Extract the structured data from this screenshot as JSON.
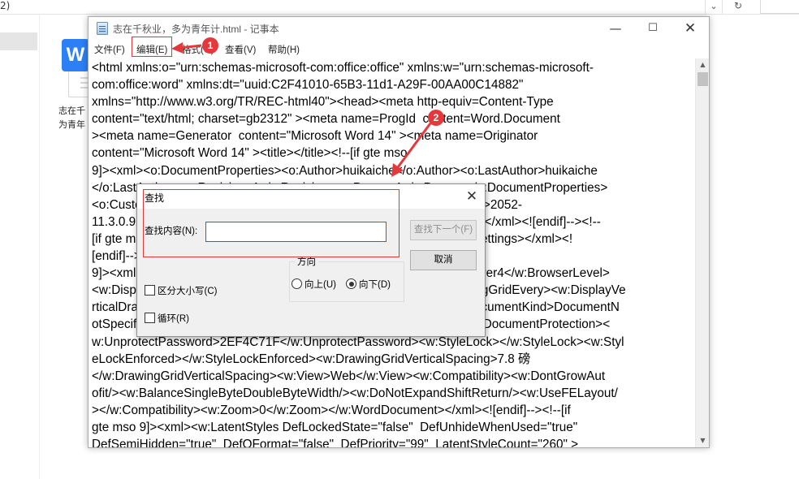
{
  "explorer": {
    "top_text": "2)",
    "refresh_icon": "refresh-icon",
    "file_name": "志在千秋业，多为青年计.docx",
    "file_name_line1": "志在千",
    "file_name_line2": "为青年",
    "file_badge": "W"
  },
  "notepad": {
    "title": "志在千秋业，多为青年计.html - 记事本",
    "menu": {
      "file": "文件(F)",
      "edit": "编辑(E)",
      "format": "格式(O)",
      "view": "查看(V)",
      "help": "帮助(H)"
    },
    "content": "<html xmlns:o=\"urn:schemas-microsoft-com:office:office\" xmlns:w=\"urn:schemas-microsoft-\ncom:office:word\" xmlns:dt=\"uuid:C2F41010-65B3-11d1-A29F-00AA00C14882\"\nxmlns=\"http://www.w3.org/TR/REC-html40\"><head><meta http-equiv=Content-Type\ncontent=\"text/html; charset=gb2312\" ><meta name=ProgId  content=Word.Document\n><meta name=Generator  content=\"Microsoft Word 14\" ><meta name=Originator\ncontent=\"Microsoft Word 14\" ><title></title><!--[if gte mso\n9]><xml><o:DocumentProperties><o:Author>huikaiche</o:Author><o:LastAuthor>huikaiche\n</o:LastAuthor><o:Revision>1</o:Revision><o:Pages>1</o:Pages></o:DocumentProperties>\n<o:CustomDocumentProperties><o:KSOProductBuildVer dt:dt=\"string\" >2052-\n11.3.0.9228</o:KSOProductBuildVer></o:CustomDocumentProperties></xml><![endif]--><!--\n[if gte mso 9]><xml><o:OfficeDocumentSettings></o:OfficeDocumentSettings></xml><!\n[endif]--><!--[if gte mso\n9]><xml><w:WordDocument><w:BrowserLevel>MicrosoftInternetExplorer4</w:BrowserLevel>\n<w:DisplayHorizontalDrawingGridEvery>0</w:DisplayHorizontalDrawingGridEvery><w:DisplayVe\nrticalDrawingGridEvery>2</w:DisplayVerticalDrawingGridEvery><w:DocumentKind>DocumentN\notSpecified</w:DocumentKind><w:DocumentProtection>ReadOnly</w:DocumentProtection><\nw:UnprotectPassword>2EF4C71F</w:UnprotectPassword><w:StyleLock></w:StyleLock><w:Styl\neLockEnforced></w:StyleLockEnforced><w:DrawingGridVerticalSpacing>7.8 磅\n</w:DrawingGridVerticalSpacing><w:View>Web</w:View><w:Compatibility><w:DontGrowAut\nofit/><w:BalanceSingleByteDoubleByteWidth/><w:DoNotExpandShiftReturn/><w:UseFELayout/\n></w:Compatibility><w:Zoom>0</w:Zoom></w:WordDocument></xml><![endif]--><!--[if\ngte mso 9]><xml><w:LatentStyles DefLockedState=\"false\"  DefUnhideWhenUsed=\"true\"\nDefSemiHidden=\"true\"  DefQFormat=\"false\"  DefPriority=\"99\"  LatentStyleCount=\"260\" >",
    "window_buttons": {
      "minimize": "—",
      "maximize": "☐",
      "close": "✕"
    },
    "scroll": {
      "up": "▲",
      "down": "▼"
    }
  },
  "find_dialog": {
    "title": "查找",
    "find_label": "查找内容(N):",
    "find_value": "",
    "find_next": "查找下一个(F)",
    "cancel": "取消",
    "direction_title": "方向",
    "direction_up": "向上(U)",
    "direction_down": "向下(D)",
    "direction_selected": "down",
    "match_case": "区分大小写(C)",
    "wrap": "循环(R)",
    "close": "✕"
  },
  "annotations": {
    "step1": "1",
    "step2": "2",
    "highlight_color": "#e0373b",
    "badge_color": "#e4393c"
  }
}
